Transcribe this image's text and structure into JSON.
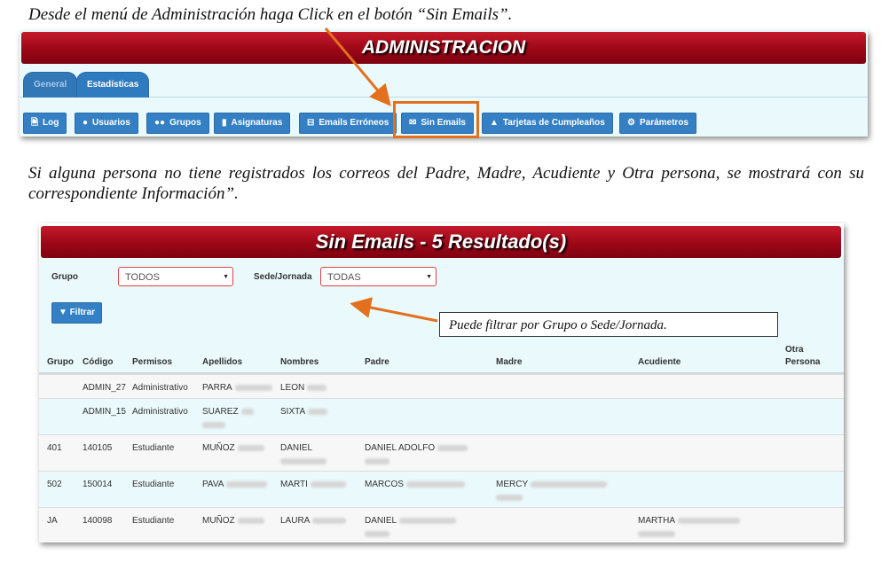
{
  "instruction1": "Desde el menú de Administración haga Click en el botón “Sin Emails”.",
  "instruction2": "Si alguna persona no tiene registrados los correos del Padre, Madre, Acudiente y Otra persona, se mostrará con su correspondiente Información”.",
  "admin": {
    "title": "ADMINISTRACION",
    "tabs": [
      {
        "label": "General"
      },
      {
        "label": "Estadísticas"
      }
    ],
    "buttons": [
      {
        "label": "Log",
        "icon": "file-icon"
      },
      {
        "label": "Usuarios",
        "icon": "user-icon"
      },
      {
        "label": "Grupos",
        "icon": "users-icon"
      },
      {
        "label": "Asignaturas",
        "icon": "book-icon"
      },
      {
        "label": "Emails Erróneos",
        "icon": "minus-square-icon"
      },
      {
        "label": "Sin Emails",
        "icon": "envelope-icon"
      },
      {
        "label": "Tarjetas de Cumpleaños",
        "icon": "cake-icon"
      },
      {
        "label": "Parámetros",
        "icon": "gear-icon"
      }
    ],
    "highlight_color": "#e2701d"
  },
  "results": {
    "title": "Sin Emails - 5 Resultado(s)",
    "filters": {
      "grupo_label": "Grupo",
      "grupo_value": "TODOS",
      "sede_label": "Sede/Jornada",
      "sede_value": "TODAS",
      "filter_button": "Filtrar"
    },
    "callout": "Puede filtrar por Grupo o Sede/Jornada.",
    "columns": [
      "Grupo",
      "Código",
      "Permisos",
      "Apellidos",
      "Nombres",
      "Padre",
      "Madre",
      "Acudiente",
      "Otra Persona"
    ],
    "rows": [
      {
        "grupo": "",
        "codigo": "ADMIN_27",
        "permisos": "Administrativo",
        "apellidos": "PARRA",
        "nombres": "LEON",
        "padre": "",
        "madre": "",
        "acudiente": "",
        "otra": ""
      },
      {
        "grupo": "",
        "codigo": "ADMIN_15",
        "permisos": "Administrativo",
        "apellidos": "SUAREZ",
        "nombres": "SIXTA",
        "padre": "",
        "madre": "",
        "acudiente": "",
        "otra": ""
      },
      {
        "grupo": "401",
        "codigo": "140105",
        "permisos": "Estudiante",
        "apellidos": "MUÑOZ",
        "nombres": "DANIEL",
        "padre": "DANIEL ADOLFO",
        "madre": "",
        "acudiente": "",
        "otra": ""
      },
      {
        "grupo": "502",
        "codigo": "150014",
        "permisos": "Estudiante",
        "apellidos": "PAVA",
        "nombres": "MARTI",
        "padre": "MARCOS",
        "madre": "MERCY",
        "acudiente": "",
        "otra": ""
      },
      {
        "grupo": "JA",
        "codigo": "140098",
        "permisos": "Estudiante",
        "apellidos": "MUÑOZ",
        "nombres": "LAURA",
        "padre": "DANIEL",
        "madre": "",
        "acudiente": "MARTHA",
        "otra": ""
      }
    ]
  }
}
